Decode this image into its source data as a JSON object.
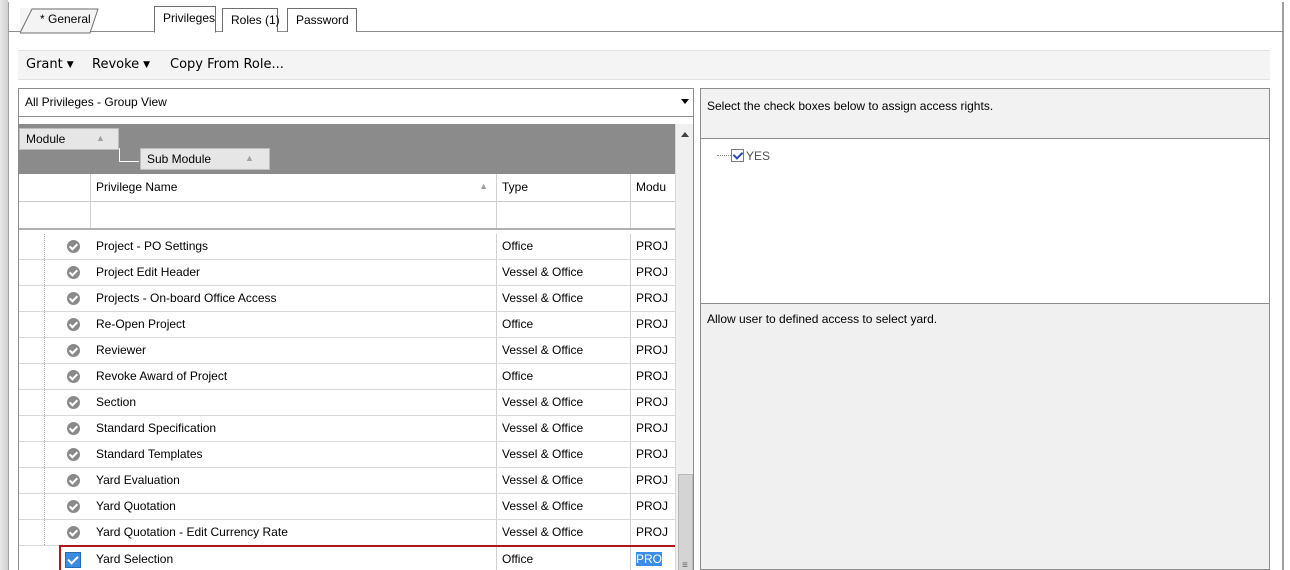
{
  "tabs": [
    {
      "label": "* General"
    },
    {
      "label": "Privileges"
    },
    {
      "label": "Roles (1)"
    },
    {
      "label": "Password"
    }
  ],
  "toolbar": {
    "grant": "Grant",
    "revoke": "Revoke",
    "copy_from_role": "Copy From Role..."
  },
  "view_select": {
    "value": "All Privileges - Group View"
  },
  "group_by": {
    "module": "Module",
    "sub_module": "Sub Module"
  },
  "columns": {
    "privilege_name": "Privilege Name",
    "type": "Type",
    "module": "Modu"
  },
  "rows": [
    {
      "name": "Project - PO Settings",
      "type": "Office",
      "module": "PROJ"
    },
    {
      "name": "Project Edit Header",
      "type": "Vessel & Office",
      "module": "PROJ"
    },
    {
      "name": "Projects - On-board Office Access",
      "type": "Vessel & Office",
      "module": "PROJ"
    },
    {
      "name": "Re-Open Project",
      "type": "Office",
      "module": "PROJ"
    },
    {
      "name": "Reviewer",
      "type": "Vessel & Office",
      "module": "PROJ"
    },
    {
      "name": "Revoke Award of Project",
      "type": "Office",
      "module": "PROJ"
    },
    {
      "name": "Section",
      "type": "Vessel & Office",
      "module": "PROJ"
    },
    {
      "name": "Standard Specification",
      "type": "Vessel & Office",
      "module": "PROJ"
    },
    {
      "name": "Standard Templates",
      "type": "Vessel & Office",
      "module": "PROJ"
    },
    {
      "name": "Yard Evaluation",
      "type": "Vessel & Office",
      "module": "PROJ"
    },
    {
      "name": "Yard Quotation",
      "type": "Vessel & Office",
      "module": "PROJ"
    },
    {
      "name": "Yard Quotation - Edit Currency Rate",
      "type": "Vessel & Office",
      "module": "PROJ"
    },
    {
      "name": "Yard Selection",
      "type": "Office",
      "module": "PRO"
    }
  ],
  "right_panel": {
    "hint": "Select the check boxes below to assign access rights.",
    "tree_node": "YES",
    "description": "Allow user to defined access to  select yard."
  },
  "colors": {
    "selected_border": "#b01818",
    "highlight": "#3a8ee6"
  }
}
